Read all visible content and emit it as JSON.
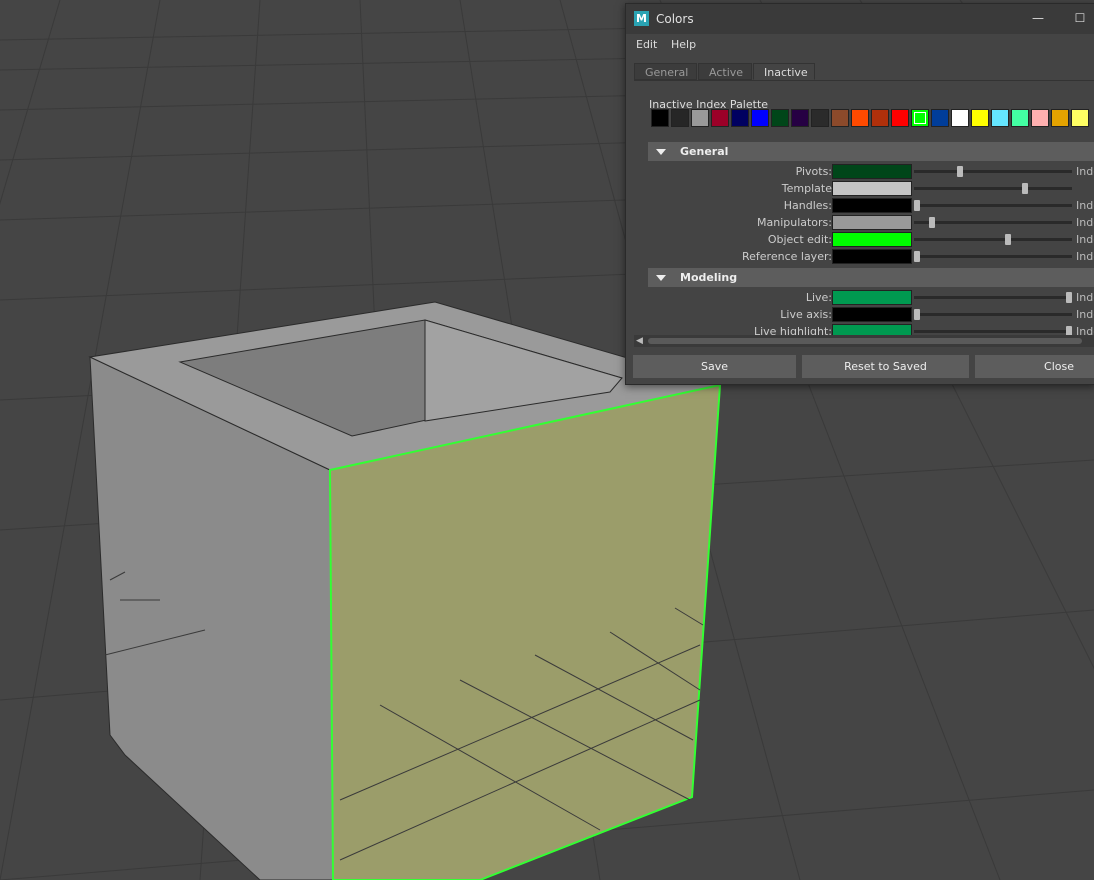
{
  "window": {
    "title": "Colors",
    "app_icon_letter": "M",
    "minimize_glyph": "—",
    "maximize_glyph": "☐"
  },
  "menu": [
    "Edit",
    "Help"
  ],
  "tabs": [
    {
      "label": "General",
      "active": false
    },
    {
      "label": "Active",
      "active": false
    },
    {
      "label": "Inactive",
      "active": true
    }
  ],
  "palette": {
    "label": "Inactive Index Palette",
    "swatches": [
      "#000000",
      "#262626",
      "#999999",
      "#9b0028",
      "#000060",
      "#0000ff",
      "#004619",
      "#260043",
      "#2b2b2b",
      "#8c4a2b",
      "#ff4a00",
      "#b0300b",
      "#ff0000",
      "#00ff00",
      "#003d99",
      "#ffffff",
      "#ffff00",
      "#65e6ff",
      "#43ffa3",
      "#ffb0b0",
      "#e4a300",
      "#ffff63"
    ],
    "selected_index": 13
  },
  "sections": [
    {
      "label": "General",
      "rows": [
        {
          "label": "Pivots:",
          "color": "#004619",
          "slider": 0.28,
          "index_label": "Index"
        },
        {
          "label": "Template",
          "color": "#c4c4c4",
          "slider": 0.71,
          "index_label": ""
        },
        {
          "label": "Handles:",
          "color": "#000000",
          "slider": 0.0,
          "index_label": "Index"
        },
        {
          "label": "Manipulators:",
          "color": "#999999",
          "slider": 0.1,
          "index_label": "Index"
        },
        {
          "label": "Object edit:",
          "color": "#00ff00",
          "slider": 0.6,
          "index_label": "Index"
        },
        {
          "label": "Reference layer:",
          "color": "#000000",
          "slider": 0.0,
          "index_label": "Index"
        }
      ]
    },
    {
      "label": "Modeling",
      "rows": [
        {
          "label": "Live:",
          "color": "#009950",
          "slider": 1.0,
          "index_label": "Index"
        },
        {
          "label": "Live axis:",
          "color": "#000000",
          "slider": 0.0,
          "index_label": "Index"
        },
        {
          "label": "Live highlight:",
          "color": "#009950",
          "slider": 1.0,
          "index_label": "Index"
        }
      ]
    }
  ],
  "scrollbar": {
    "left_arrow": "◀"
  },
  "buttons": {
    "save": "Save",
    "reset": "Reset to Saved",
    "close": "Close"
  },
  "scene": {
    "background": "#454545",
    "grid_color": "#3a3a3a",
    "mesh_face_color": "#8a8a8a",
    "selected_face_color": "#9b9d6a",
    "selection_edge_color": "#33ff33"
  }
}
